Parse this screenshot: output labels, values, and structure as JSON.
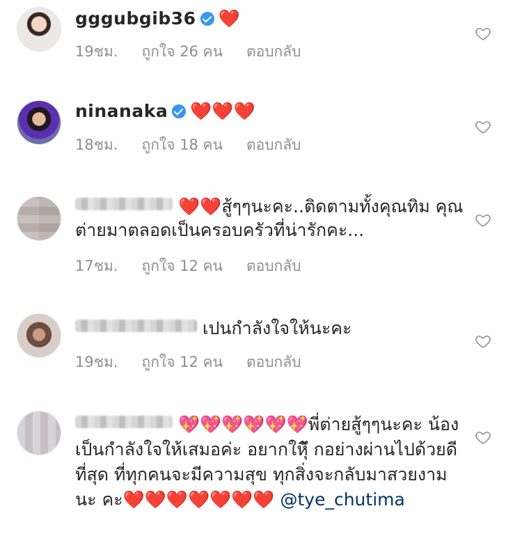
{
  "comments": [
    {
      "username": "gggubgib36",
      "verified": true,
      "text": "❤️",
      "time": "19ชม.",
      "likes": "ถูกใจ 26 คน",
      "reply": "ตอบกลับ"
    },
    {
      "username": "ninanaka",
      "verified": true,
      "text": "❤️❤️❤️",
      "time": "18ชม.",
      "likes": "ถูกใจ 18 คน",
      "reply": "ตอบกลับ"
    },
    {
      "username": "",
      "verified": false,
      "text_hearts": "❤️❤️",
      "text": "สู้ๆๆนะคะ..ติดตามทั้งคุณทิม คุณต่ายมาตลอดเป็นครอบครัวที่น่ารักคะ...",
      "time": "17ชม.",
      "likes": "ถูกใจ 12 คน",
      "reply": "ตอบกลับ"
    },
    {
      "username": "",
      "verified": false,
      "text": "เปนกำลังใจให้นะคะ",
      "time": "19ชม.",
      "likes": "ถูกใจ 12 คน",
      "reply": "ตอบกลับ"
    },
    {
      "username": "",
      "verified": false,
      "text_sparkles": "💖💖💖💖💖💖",
      "text": "พี่ต่ายสู้ๆๆนะคะ น้องเป็นกำลังใจให้เสมอค่ะ อยากใหุ้ึ กอย่างผ่านไปด้วยดีที่สุด ที่ทุกคนจะมีความสุข ทุกสิ่งจะกลับมาสวยงามนะ คะ",
      "text_end_hearts": "❤️❤️❤️❤️❤️❤️❤️",
      "mention": "@tye_chutima"
    }
  ],
  "icons": {
    "like": "heart-outline-icon",
    "verified": "verified-badge-icon"
  },
  "colors": {
    "verified": "#3897f0",
    "heart": "#ed2b2b",
    "meta": "#8e8e8e",
    "mention": "#003569"
  }
}
